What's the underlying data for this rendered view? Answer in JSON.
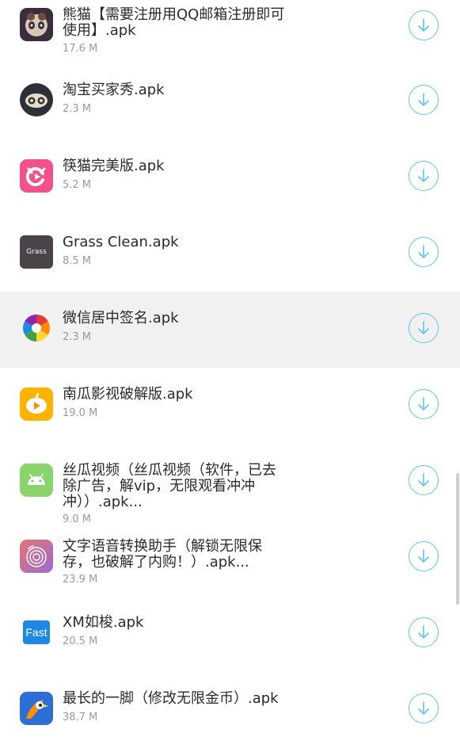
{
  "apps": [
    {
      "title": "熊猫【需要注册用QQ邮箱注册即可\n使用】.apk",
      "size": "17.6 M",
      "icon": "panda-icon",
      "color": "#3a2d3d"
    },
    {
      "title": "淘宝买家秀.apk",
      "size": "2.3 M",
      "icon": "owl-icon",
      "color": "#2e3038"
    },
    {
      "title": "筷猫完美版.apk",
      "size": "5.2 M",
      "icon": "cat-video-icon",
      "color": "#f5508c"
    },
    {
      "title": "Grass Clean.apk",
      "size": "8.5 M",
      "icon": "grass-icon",
      "color": "#4a4348",
      "icon_text": "Grass"
    },
    {
      "title": "微信居中签名.apk",
      "size": "2.3 M",
      "icon": "aperture-icon",
      "color": "#ffffff",
      "highlighted": true
    },
    {
      "title": "南瓜影视破解版.apk",
      "size": "19.0 M",
      "icon": "pumpkin-play-icon",
      "color": "#ffb300"
    },
    {
      "title": "丝瓜视频（丝瓜视频（软件，已去\n除广告，解vip，无限观看冲冲\n冲））.apk...",
      "size": "9.0 M",
      "icon": "android-icon",
      "color": "#8bd46b"
    },
    {
      "title": "文字语音转换助手（解锁无限保\n存，也破解了内购！）.apk...",
      "size": "23.9 M",
      "icon": "fingerprint-icon",
      "color": "#b76bb9"
    },
    {
      "title": "XM如梭.apk",
      "size": "20.5 M",
      "icon": "fast-icon",
      "color": "#1e88e5",
      "icon_text": "Fast"
    },
    {
      "title": "最长的一脚（修改无限金币）.apk",
      "size": "38.7 M",
      "icon": "bird-icon",
      "color": "#2b6fd6"
    }
  ]
}
